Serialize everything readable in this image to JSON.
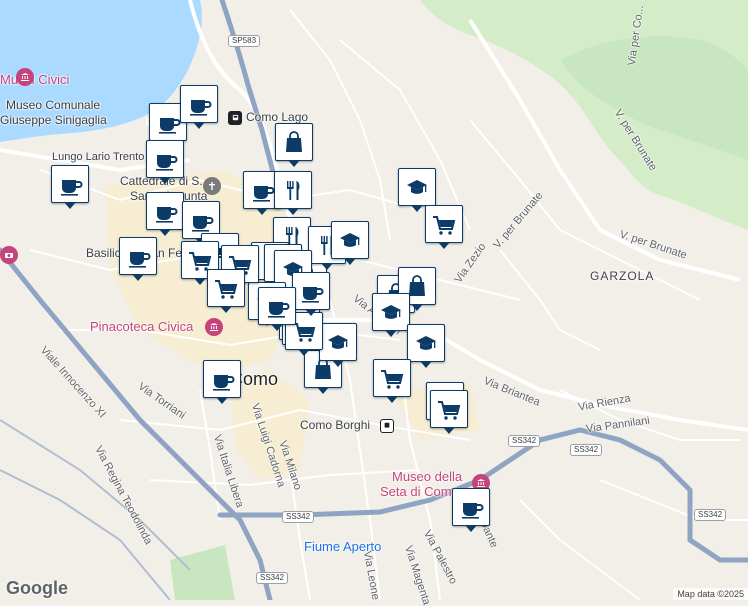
{
  "map": {
    "water_color": "#aadaff",
    "park_color": "#c8e6c0",
    "building_area_color": "#f6edd2",
    "road_color": "#ffffff",
    "highway_color": "#8ea4c2",
    "marker_border": "#0b3b66"
  },
  "labels": {
    "museum_comunale_1": "Musei Civici",
    "museum_comunale_2": "Museo Comunale",
    "giuseppe_sinigaglia": "Giuseppe Sinigaglia",
    "lungo_lario_trento": "Lungo Lario Trento",
    "como_lago": "Como Lago",
    "cattedrale_1": "Cattedrale di S...",
    "cattedrale_2": "Santa Assunta",
    "basilica": "Basilica di San Fedele",
    "pinacoteca": "Pinacoteca Civica",
    "como": "Como",
    "como_borghi": "Como Borghi",
    "museo_seta_1": "Museo della",
    "museo_seta_2": "Seta di Como",
    "fiume_aperto": "Fiume Aperto",
    "garzola": "GARZOLA",
    "via_briantea": "Via Briantea",
    "via_rienza": "Via Rienza",
    "via_pannilani": "Via Pannilani",
    "via_zezio": "Via Zezio",
    "v_per_brunate_1": "V. per Brunate",
    "v_per_brunate_2": "V. per Brunate",
    "via_per_co": "Via per Co...",
    "v_per_brunate_3": "V. per Brunate",
    "via_alighieri": "Via Alighieri",
    "via_innocenzo": "Viale Innocenzo XI",
    "via_torriani": "Via Torriani",
    "via_luigi_cadorna": "Via Luigi Cadorna",
    "via_milano": "Via Milano",
    "via_italia_libera": "Via Italia Libera",
    "via_regina_teodolinda": "Via Regina Teodolinda",
    "via_leone": "Via Leone",
    "via_magenta": "Via Magenta",
    "via_palestro": "Via Palestro",
    "via_dante": "Via Dante"
  },
  "shields": [
    "SP583",
    "SS342",
    "SS342",
    "SS342",
    "SS342",
    "SS342"
  ],
  "google_logo": "Google",
  "attribution": "Map data ©2025",
  "markers": [
    {
      "type": "cafe"
    },
    {
      "type": "cafe"
    },
    {
      "type": "cafe"
    },
    {
      "type": "cafe"
    },
    {
      "type": "cafe"
    },
    {
      "type": "cafe"
    },
    {
      "type": "cafe"
    },
    {
      "type": "cafe"
    },
    {
      "type": "cafe"
    },
    {
      "type": "cafe"
    },
    {
      "type": "shop"
    },
    {
      "type": "shop"
    },
    {
      "type": "shop"
    },
    {
      "type": "shop"
    },
    {
      "type": "shop"
    },
    {
      "type": "restaurant"
    },
    {
      "type": "restaurant"
    },
    {
      "type": "restaurant"
    },
    {
      "type": "restaurant"
    },
    {
      "type": "restaurant"
    },
    {
      "type": "school"
    },
    {
      "type": "school"
    },
    {
      "type": "school"
    },
    {
      "type": "school"
    },
    {
      "type": "school"
    },
    {
      "type": "school"
    },
    {
      "type": "school"
    },
    {
      "type": "school"
    },
    {
      "type": "grocery"
    },
    {
      "type": "grocery"
    },
    {
      "type": "grocery"
    },
    {
      "type": "grocery"
    },
    {
      "type": "grocery"
    },
    {
      "type": "grocery"
    },
    {
      "type": "grocery"
    },
    {
      "type": "grocery"
    },
    {
      "type": "grocery"
    },
    {
      "type": "grocery"
    },
    {
      "type": "cafe"
    },
    {
      "type": "cafe"
    }
  ]
}
